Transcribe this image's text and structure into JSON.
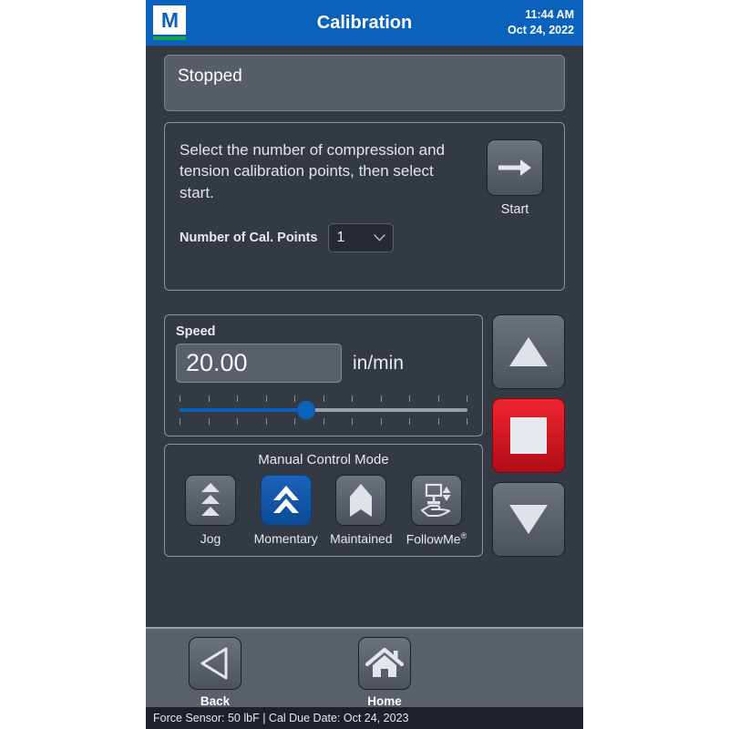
{
  "header": {
    "logo_letter": "M",
    "title": "Calibration",
    "time": "11:44 AM",
    "date": "Oct 24, 2022"
  },
  "status": {
    "text": "Stopped"
  },
  "instructions": {
    "text": "Select the number of compression and tension calibration points, then select start.",
    "cal_points_label": "Number of Cal. Points",
    "cal_points_value": "1",
    "start_label": "Start"
  },
  "speed": {
    "label": "Speed",
    "value": "20.00",
    "unit": "in/min",
    "slider_percent": 44,
    "tick_count": 11
  },
  "manual_control": {
    "title": "Manual Control Mode",
    "modes": [
      {
        "label": "Jog",
        "icon": "triple-up-triangle-icon",
        "active": false
      },
      {
        "label": "Momentary",
        "icon": "double-chevron-up-icon",
        "active": true
      },
      {
        "label": "Maintained",
        "icon": "pennant-up-icon",
        "active": false
      },
      {
        "label": "FollowMe",
        "superscript": "®",
        "icon": "hand-press-icon",
        "active": false
      }
    ]
  },
  "jog_controls": {
    "up_label": "up-arrow",
    "stop_label": "stop",
    "down_label": "down-arrow"
  },
  "navbar": {
    "back_label": "Back",
    "home_label": "Home"
  },
  "footer": {
    "text": "Force Sensor: 50 lbF   |   Cal Due Date: Oct 24, 2023"
  },
  "colors": {
    "header_blue": "#0a62bd",
    "accent_blue": "#0a62bd",
    "stop_red": "#ef2430",
    "logo_green": "#17a74a",
    "background": "#343a43",
    "panel_border": "#8e949d"
  }
}
